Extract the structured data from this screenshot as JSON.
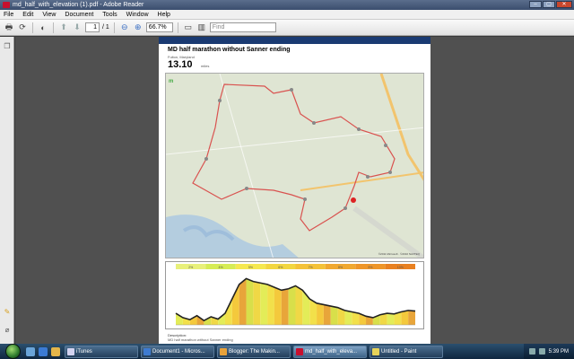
{
  "window": {
    "title": "md_half_with_elevation (1).pdf - Adobe Reader",
    "controls": [
      "minimize",
      "maximize",
      "close"
    ]
  },
  "menu": [
    "File",
    "Edit",
    "View",
    "Document",
    "Tools",
    "Window",
    "Help"
  ],
  "toolbar": {
    "page_current": "1",
    "page_total": "/ 1",
    "zoom": "66.7%",
    "find_placeholder": "Find"
  },
  "document": {
    "title": "MD half marathon without Sanner ending",
    "location": "Fulton, Maryland",
    "distance": "13.10",
    "distance_unit": "miles",
    "map_credit": "©2011 Microsoft · ©2010 NAVTEQ",
    "description_label": "Description:",
    "description": "MD half marathon without Sanner ending"
  },
  "elevation": {
    "grade_labels": [
      "2%",
      "4%",
      "5%",
      "6%",
      "7%",
      "8%",
      "9%",
      "10%"
    ],
    "profile": [
      420,
      405,
      398,
      412,
      395,
      408,
      400,
      420,
      470,
      520,
      540,
      530,
      525,
      520,
      510,
      500,
      505,
      515,
      500,
      470,
      455,
      450,
      445,
      440,
      430,
      425,
      420,
      410,
      405,
      415,
      420,
      418,
      425,
      430,
      428
    ]
  },
  "taskbar": {
    "tasks": [
      {
        "label": "iTunes",
        "color": "#d3d3f0"
      },
      {
        "label": "Document1 - Micros...",
        "color": "#3e7bd1"
      },
      {
        "label": "Blogger: The Makin...",
        "color": "#e8a23a"
      },
      {
        "label": "md_half_with_eleva...",
        "color": "#c8102e",
        "active": true
      },
      {
        "label": "Untitled - Paint",
        "color": "#e6d35a"
      }
    ],
    "clock": "5:39 PM"
  }
}
